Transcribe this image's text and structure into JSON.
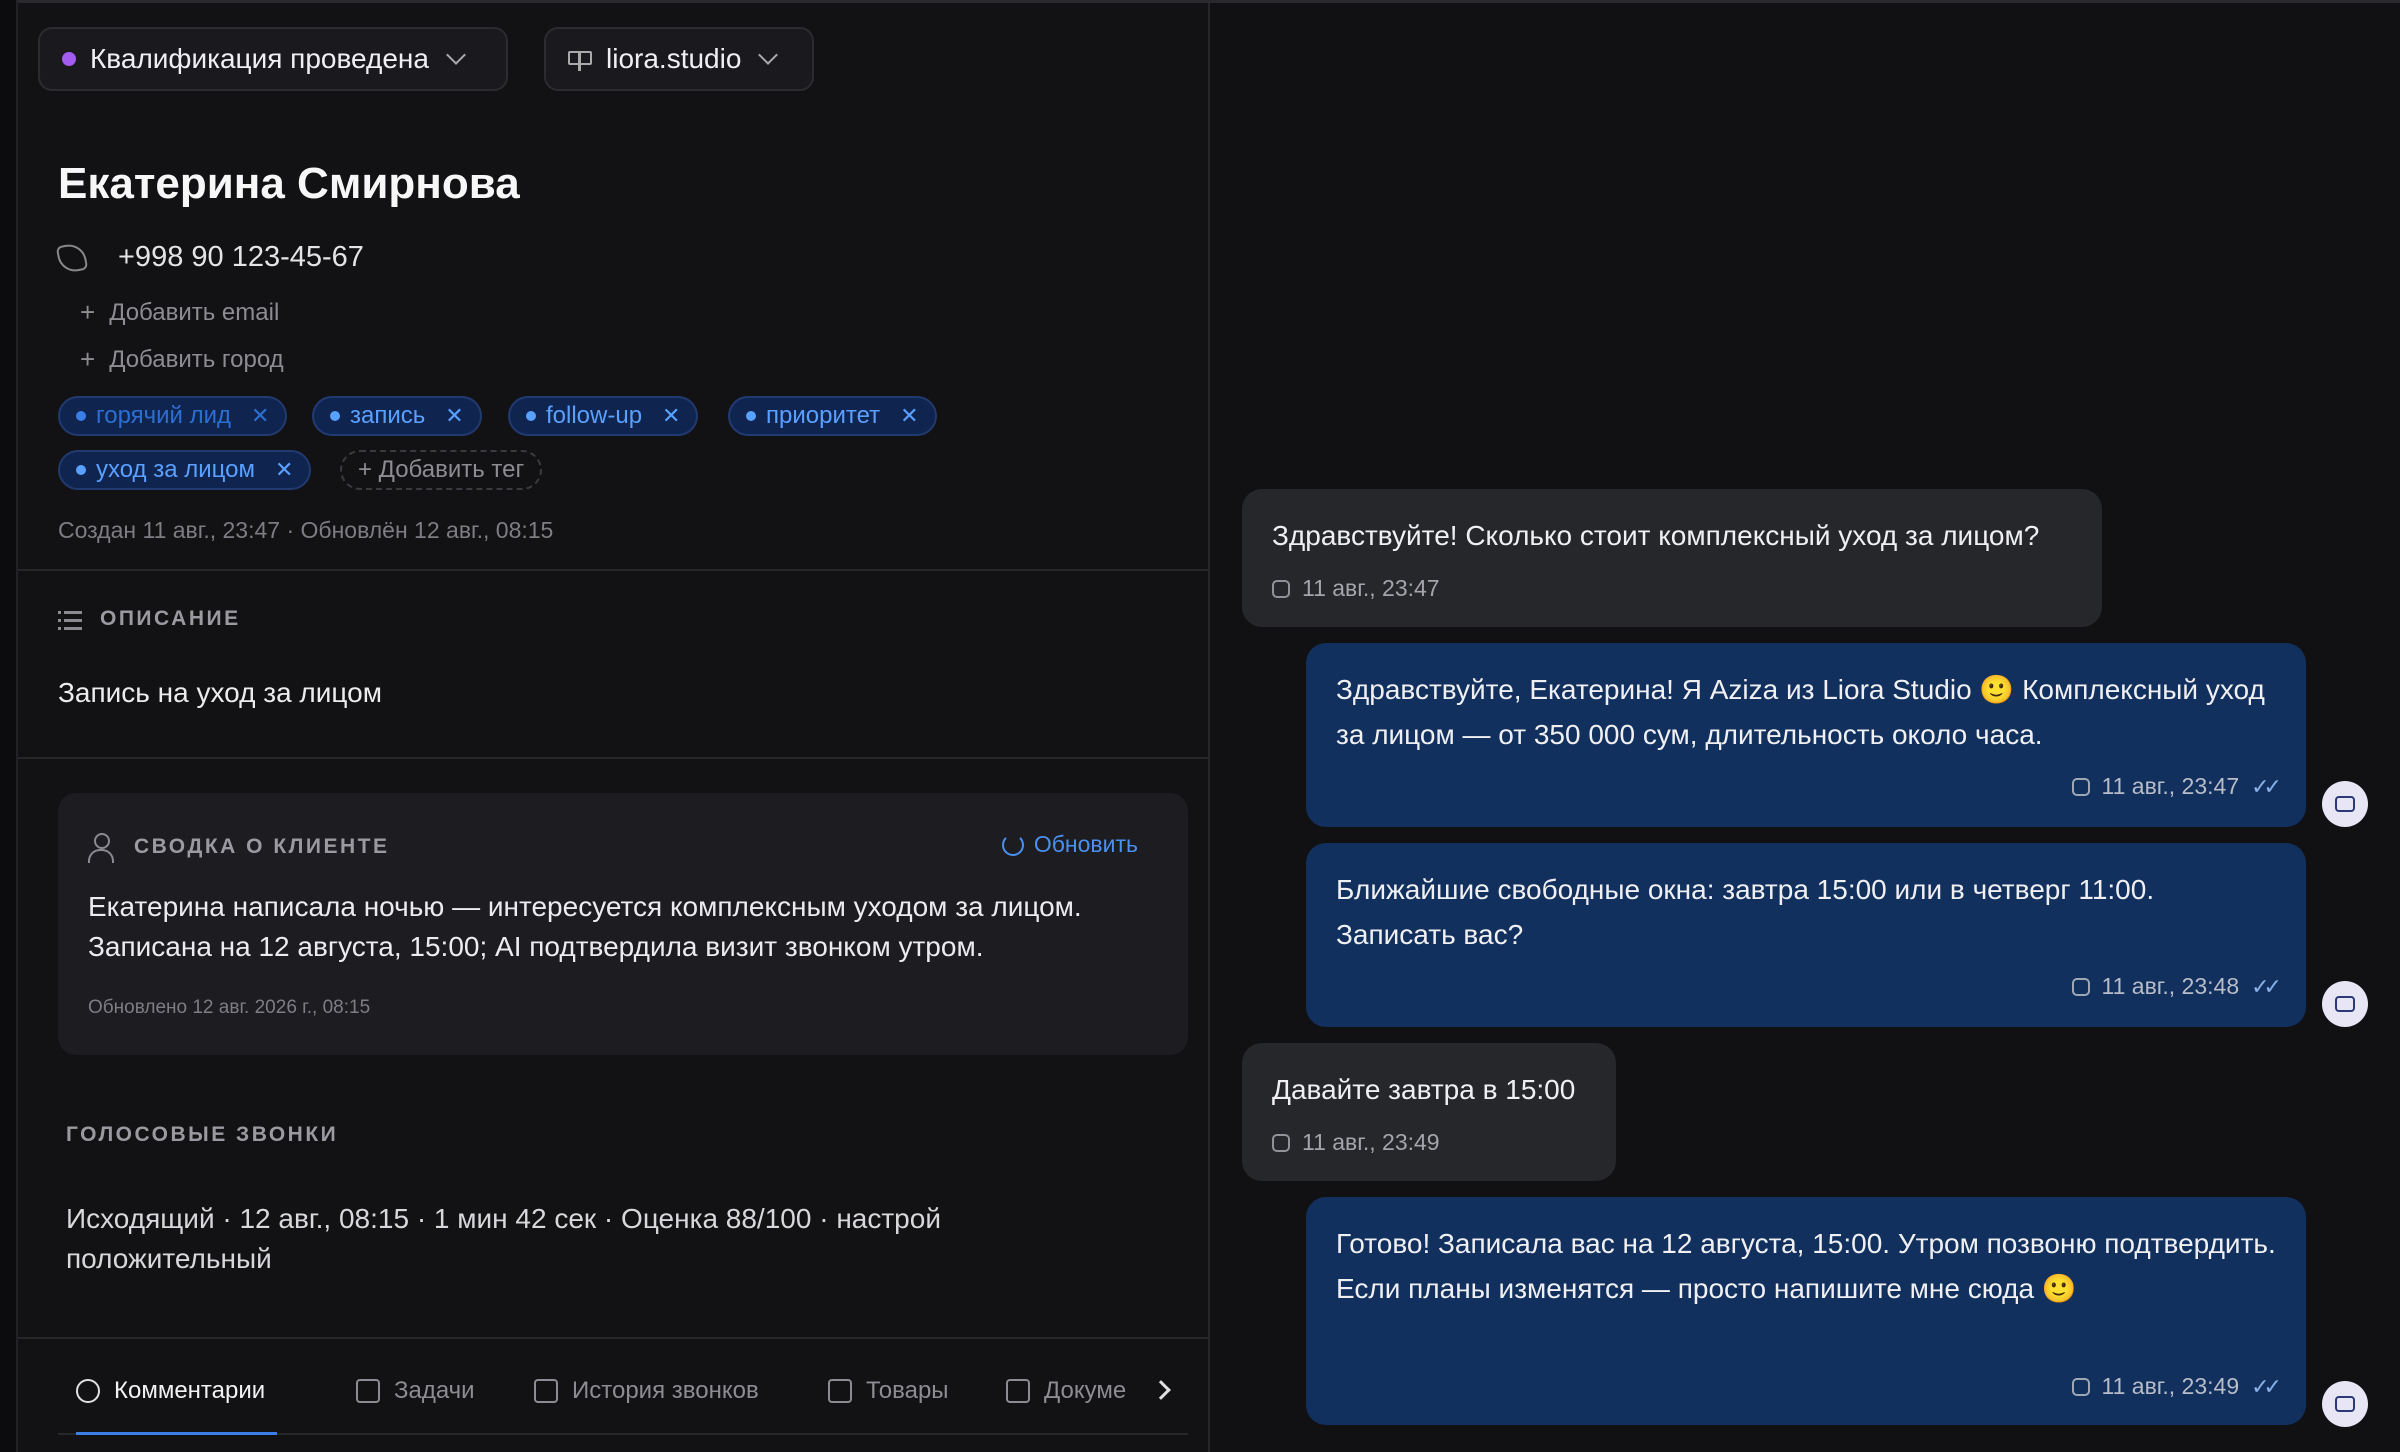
{
  "header": {
    "status_label": "Квалификация проведена",
    "status_color": "#a35cf0",
    "source_label": "liora.studio"
  },
  "contact": {
    "name": "Екатерина Смирнова",
    "phone": "+998 90 123-45-67",
    "add_email": "Добавить email",
    "add_city": "Добавить город"
  },
  "tags": [
    "горячий лид",
    "запись",
    "follow-up",
    "приоритет",
    "уход за лицом"
  ],
  "add_tag_label": "+ Добавить тег",
  "meta_line": "Создан 11 авг., 23:47 · Обновлён 12 авг., 08:15",
  "description": {
    "title": "ОПИСАНИЕ",
    "text": "Запись на уход за лицом"
  },
  "summary": {
    "title": "СВОДКА О КЛИЕНТЕ",
    "refresh_label": "Обновить",
    "text": "Екатерина написала ночью — интересуется комплексным уходом за лицом. Записана на 12 августа, 15:00; AI подтвердила визит звонком утром.",
    "updated": "Обновлено 12 авг. 2026 г., 08:15"
  },
  "voice_calls": {
    "title": "ГОЛОСОВЫЕ ЗВОНКИ",
    "text": "Исходящий · 12 авг., 08:15 · 1 мин 42 сек · Оценка 88/100 · настрой положительный"
  },
  "tabs": [
    "Комментарии",
    "Задачи",
    "История звонков",
    "Товары",
    "Докуме"
  ],
  "messages": [
    {
      "dir": "in",
      "text": "Здравствуйте! Сколько стоит комплексный уход за лицом?",
      "time": "11 авг., 23:47"
    },
    {
      "dir": "out",
      "text": "Здравствуйте, Екатерина! Я Aziza из Liora Studio 🙂 Комплексный уход за лицом — от 350 000 сум, длительность около часа.",
      "time": "11 авг., 23:47"
    },
    {
      "dir": "out",
      "text": "Ближайшие свободные окна: завтра 15:00 или в четверг 11:00. Записать вас?",
      "time": "11 авг., 23:48"
    },
    {
      "dir": "in",
      "text": "Давайте завтра в 15:00",
      "time": "11 авг., 23:49"
    },
    {
      "dir": "out",
      "text": "Готово! Записала вас на 12 августа, 15:00. Утром позвоню подтвердить. Если планы изменятся — просто напишите мне сюда 🙂",
      "time": "11 авг., 23:49"
    }
  ],
  "icons": [
    "phone-icon",
    "plus-icon",
    "close-icon",
    "list-icon",
    "person-icon",
    "refresh-icon",
    "instagram-icon",
    "double-check-icon",
    "bot-avatar-icon",
    "chevron-down-icon",
    "chevron-right-icon"
  ]
}
